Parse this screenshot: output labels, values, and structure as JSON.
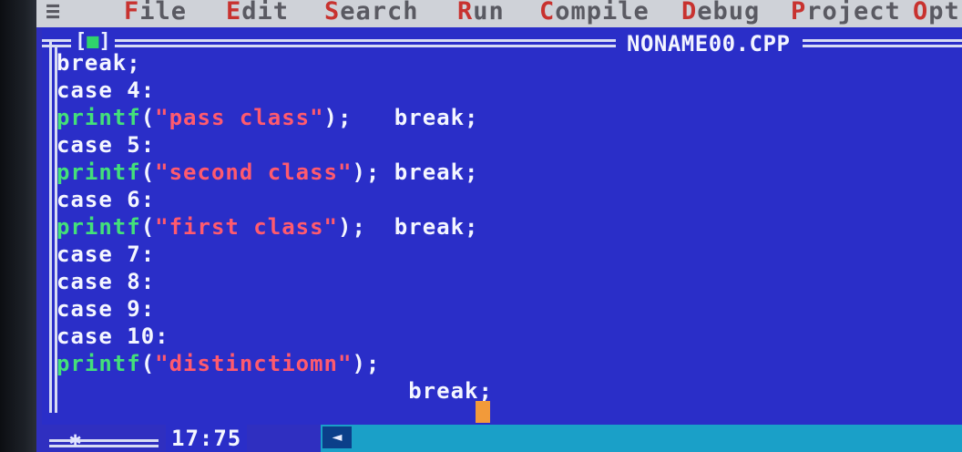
{
  "menubar": {
    "items": [
      {
        "hot": "F",
        "rest": "ile"
      },
      {
        "hot": "E",
        "rest": "dit"
      },
      {
        "hot": "S",
        "rest": "earch"
      },
      {
        "hot": "R",
        "rest": "un"
      },
      {
        "hot": "C",
        "rest": "ompile"
      },
      {
        "hot": "D",
        "rest": "ebug"
      },
      {
        "hot": "P",
        "rest": "roject"
      },
      {
        "hot": "O",
        "rest": "pt"
      }
    ],
    "system_menu": "≡"
  },
  "editor": {
    "close_box_left": "[",
    "close_box_dot": "■",
    "close_box_right": "]",
    "title": "NONAME00.CPP",
    "code_lines": [
      {
        "kw": "break;"
      },
      {
        "kw": "case 4:"
      },
      {
        "fn": "printf",
        "open": "(",
        "str": "\"pass class\"",
        "close": ");",
        "after": "   break;"
      },
      {
        "kw": "case 5:"
      },
      {
        "fn": "printf",
        "open": "(",
        "str": "\"second class\"",
        "close": ");",
        "after": " break;"
      },
      {
        "kw": "case 6:"
      },
      {
        "fn": "printf",
        "open": "(",
        "str": "\"first class\"",
        "close": ");",
        "after": "  break;"
      },
      {
        "kw": "case 7:"
      },
      {
        "kw": "case 8:"
      },
      {
        "kw": "case 9:"
      },
      {
        "kw": "case 10:"
      },
      {
        "fn": "printf",
        "open": "(",
        "str": "\"distinctiomn\"",
        "close": ");",
        "after": ""
      },
      {
        "kw": "                         break;"
      }
    ]
  },
  "status": {
    "frame_marker": "✱",
    "cursor_position": "17:75",
    "scroll_left_arrow": "◄"
  },
  "colors": {
    "screen_bg": "#2a2ec8",
    "menubar_bg": "#cfd2d8",
    "menu_hotkey": "#c8322f",
    "function": "#43e07a",
    "string": "#ff5a6e",
    "cursor": "#f29a3a",
    "scrollbar": "#1aa0c8"
  }
}
